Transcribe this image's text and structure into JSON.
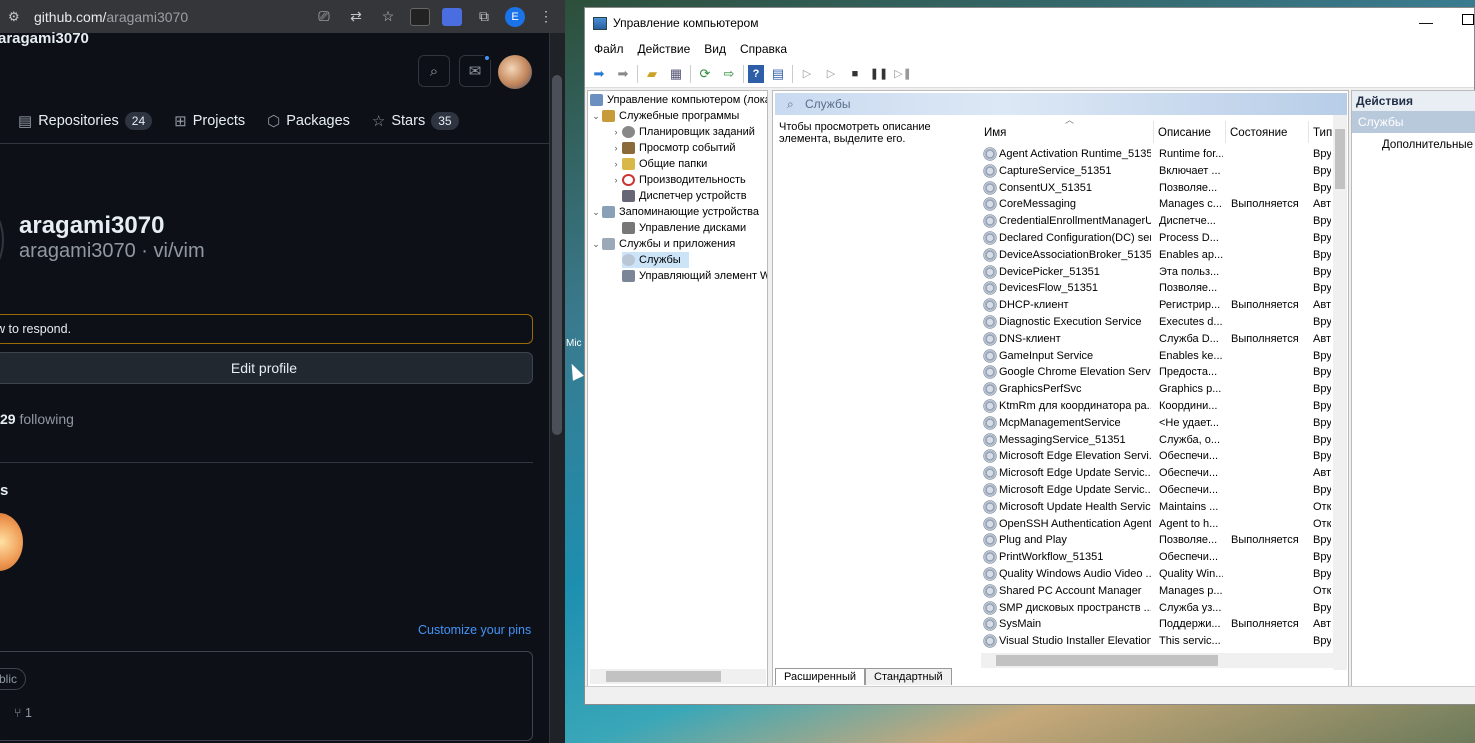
{
  "browser": {
    "url_host": "github.com/",
    "url_path": "aragami3070",
    "header_username": "aragami3070",
    "tabs": [
      {
        "label": "Repositories",
        "count": "24"
      },
      {
        "label": "Projects",
        "count": ""
      },
      {
        "label": "Packages",
        "count": ""
      },
      {
        "label": "Stars",
        "count": "35"
      }
    ],
    "profile_name": "aragami3070",
    "profile_sub": "aragami3070 · vi/vim",
    "status_text": "w to respond.",
    "edit_profile": "Edit profile",
    "following_count": "29",
    "following_label": " following",
    "section_title": "s",
    "customize_pins": "Customize your pins",
    "public_badge": "blic",
    "fork_count": "1",
    "profile_badge_letter": "E"
  },
  "desktop": {
    "icon_label": "Mic"
  },
  "mmc": {
    "title": "Управление компьютером",
    "menu": [
      "Файл",
      "Действие",
      "Вид",
      "Справка"
    ],
    "tree": [
      {
        "label": "Управление компьютером (лока",
        "exp": "",
        "level": 0
      },
      {
        "label": "Служебные программы",
        "exp": "⌄",
        "level": 1
      },
      {
        "label": "Планировщик заданий",
        "exp": "›",
        "level": 2
      },
      {
        "label": "Просмотр событий",
        "exp": "›",
        "level": 2
      },
      {
        "label": "Общие папки",
        "exp": "›",
        "level": 2
      },
      {
        "label": "Производительность",
        "exp": "›",
        "level": 2
      },
      {
        "label": "Диспетчер устройств",
        "exp": "",
        "level": 2
      },
      {
        "label": "Запоминающие устройства",
        "exp": "⌄",
        "level": 1
      },
      {
        "label": "Управление дисками",
        "exp": "",
        "level": 2
      },
      {
        "label": "Службы и приложения",
        "exp": "⌄",
        "level": 1
      },
      {
        "label": "Службы",
        "exp": "",
        "level": 2,
        "selected": true
      },
      {
        "label": "Управляющий элемент W",
        "exp": "",
        "level": 2
      }
    ],
    "services_header": "Службы",
    "description_hint": "Чтобы просмотреть описание элемента, выделите его.",
    "columns": {
      "name": "Имя",
      "desc": "Описание",
      "state": "Состояние",
      "type": "Тип"
    },
    "services": [
      {
        "name": "Agent Activation Runtime_51351",
        "desc": "Runtime for...",
        "state": "",
        "type": "Вру"
      },
      {
        "name": "CaptureService_51351",
        "desc": "Включает ...",
        "state": "",
        "type": "Вру"
      },
      {
        "name": "ConsentUX_51351",
        "desc": "Позволяе...",
        "state": "",
        "type": "Вру"
      },
      {
        "name": "CoreMessaging",
        "desc": "Manages c...",
        "state": "Выполняется",
        "type": "Авт"
      },
      {
        "name": "CredentialEnrollmentManagerU...",
        "desc": "Диспетче...",
        "state": "",
        "type": "Вру"
      },
      {
        "name": "Declared Configuration(DC) ser...",
        "desc": "Process D...",
        "state": "",
        "type": "Вру"
      },
      {
        "name": "DeviceAssociationBroker_51351",
        "desc": "Enables ap...",
        "state": "",
        "type": "Вру"
      },
      {
        "name": "DevicePicker_51351",
        "desc": "Эта польз...",
        "state": "",
        "type": "Вру"
      },
      {
        "name": "DevicesFlow_51351",
        "desc": "Позволяе...",
        "state": "",
        "type": "Вру"
      },
      {
        "name": "DHCP-клиент",
        "desc": "Регистрир...",
        "state": "Выполняется",
        "type": "Авт"
      },
      {
        "name": "Diagnostic Execution Service",
        "desc": "Executes d...",
        "state": "",
        "type": "Вру"
      },
      {
        "name": "DNS-клиент",
        "desc": "Служба D...",
        "state": "Выполняется",
        "type": "Авт"
      },
      {
        "name": "GameInput Service",
        "desc": "Enables ke...",
        "state": "",
        "type": "Вру"
      },
      {
        "name": "Google Chrome Elevation Servi...",
        "desc": "Предоста...",
        "state": "",
        "type": "Вру"
      },
      {
        "name": "GraphicsPerfSvc",
        "desc": "Graphics p...",
        "state": "",
        "type": "Вру"
      },
      {
        "name": "KtmRm для координатора ра...",
        "desc": "Координи...",
        "state": "",
        "type": "Вру"
      },
      {
        "name": "McpManagementService",
        "desc": "<Не удает...",
        "state": "",
        "type": "Вру"
      },
      {
        "name": "MessagingService_51351",
        "desc": "Служба, о...",
        "state": "",
        "type": "Вру"
      },
      {
        "name": "Microsoft Edge Elevation Servi...",
        "desc": "Обеспечи...",
        "state": "",
        "type": "Вру"
      },
      {
        "name": "Microsoft Edge Update Servic...",
        "desc": "Обеспечи...",
        "state": "",
        "type": "Авт"
      },
      {
        "name": "Microsoft Edge Update Servic...",
        "desc": "Обеспечи...",
        "state": "",
        "type": "Вру"
      },
      {
        "name": "Microsoft Update Health Service",
        "desc": "Maintains ...",
        "state": "",
        "type": "Отк"
      },
      {
        "name": "OpenSSH Authentication Agent",
        "desc": "Agent to h...",
        "state": "",
        "type": "Отк"
      },
      {
        "name": "Plug and Play",
        "desc": "Позволяе...",
        "state": "Выполняется",
        "type": "Вру"
      },
      {
        "name": "PrintWorkflow_51351",
        "desc": "Обеспечи...",
        "state": "",
        "type": "Вру"
      },
      {
        "name": "Quality Windows Audio Video ...",
        "desc": "Quality Win...",
        "state": "",
        "type": "Вру"
      },
      {
        "name": "Shared PC Account Manager",
        "desc": "Manages p...",
        "state": "",
        "type": "Отк"
      },
      {
        "name": "SMP дисковых пространств ...",
        "desc": "Служба уз...",
        "state": "",
        "type": "Вру"
      },
      {
        "name": "SysMain",
        "desc": "Поддержи...",
        "state": "Выполняется",
        "type": "Авт"
      },
      {
        "name": "Visual Studio Installer Elevation...",
        "desc": "This servic...",
        "state": "",
        "type": "Вру"
      }
    ],
    "tab_extended": "Расширенный",
    "tab_standard": "Стандартный",
    "actions_title": "Действия",
    "actions_sub": "Службы",
    "actions_more": "Дополнительные"
  }
}
